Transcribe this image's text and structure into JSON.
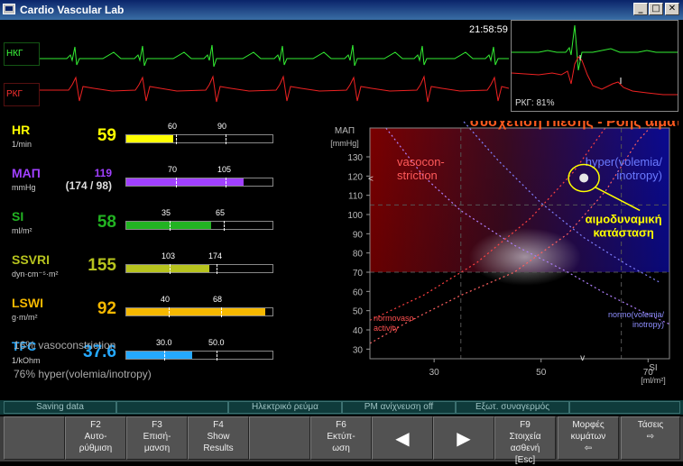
{
  "window": {
    "title": "Cardio Vascular Lab",
    "min": "_",
    "max": "□",
    "close": "✕"
  },
  "ecg": {
    "clock": "21:58:59",
    "lead1": "НКГ",
    "lead2": "РКГ",
    "mini_label": "РКГ: 81%"
  },
  "vitals": [
    {
      "name": "HR",
      "unit": "1/min",
      "value": "59",
      "color": "#ffff00",
      "ticks": [
        "60",
        "90"
      ],
      "fill_pct": 32
    },
    {
      "name": "ΜΑΠ",
      "unit": "mmHg",
      "value": "119",
      "value2": "(174 / 98)",
      "color": "#a040ff",
      "ticks": [
        "70",
        "105"
      ],
      "fill_pct": 80
    },
    {
      "name": "SI",
      "unit": "ml/m²",
      "value": "58",
      "color": "#22b322",
      "ticks": [
        "35",
        "65"
      ],
      "fill_pct": 58
    },
    {
      "name": "SSVRI",
      "unit": "dyn·cm⁻⁵·m²",
      "value": "155",
      "color": "#b7c31e",
      "ticks": [
        "103",
        "174"
      ],
      "fill_pct": 57
    },
    {
      "name": "LSWI",
      "unit": "g·m/m²",
      "value": "92",
      "color": "#f5b800",
      "ticks": [
        "40",
        "68"
      ],
      "fill_pct": 95
    },
    {
      "name": "TFC",
      "unit": "1/kOhm",
      "value": "37.6",
      "color": "#25a9ff",
      "ticks": [
        "30.0",
        "50.0"
      ],
      "fill_pct": 45
    }
  ],
  "notes": [
    "16% vasoconstriction",
    "76% hyper(volemia/inotropy)"
  ],
  "chart_data": {
    "type": "scatter",
    "title": "συσχέτιση Πίεσης - Ροής αίματος",
    "ylabel": "ΜΑΠ",
    "yunit": "[mmHg]",
    "xlabel": "SI",
    "xunit": "[ml/m²]",
    "xlim": [
      18,
      74
    ],
    "ylim": [
      25,
      145
    ],
    "xticks": [
      30,
      50,
      70
    ],
    "yticks": [
      30,
      40,
      50,
      60,
      70,
      80,
      90,
      100,
      110,
      120,
      130
    ],
    "dashed_x": [
      35,
      65
    ],
    "dashed_y": [
      70,
      105
    ],
    "points": [
      {
        "x": 58,
        "y": 119
      }
    ],
    "regions": {
      "top_left": "vasocon-\nstriction",
      "top_right": "hyper(volemia/\ninotropy)",
      "bottom_left": "normovaso-\nactivity",
      "bottom_right": "normo(volemia/\ninotropy)"
    },
    "annotation": "αιμοδυναμική\nκατάσταση"
  },
  "statusbar": [
    "Saving data",
    "",
    "Ηλεκτρικό ρεύμα",
    "PM ανίχνευση off",
    "Εξωτ. συναγερμός",
    ""
  ],
  "fkeys": [
    {
      "label": "",
      "name": "fkey-blank-1"
    },
    {
      "label": "F2\nΑυτο-\nρύθμιση",
      "name": "fkey-f2"
    },
    {
      "label": "F3\nΕπισή-\nμανση",
      "name": "fkey-f3"
    },
    {
      "label": "F4\nShow\nResults",
      "name": "fkey-f4"
    },
    {
      "label": "",
      "name": "fkey-blank-2"
    },
    {
      "label": "F6\nΕκτύπ-\nωση",
      "name": "fkey-f6"
    },
    {
      "label": "◀",
      "name": "fkey-prev"
    },
    {
      "label": "▶",
      "name": "fkey-next"
    },
    {
      "label": "F9\nΣτοιχεία ασθενή\n[Esc]",
      "name": "fkey-f9"
    },
    {
      "label": "Μορφές\nκυμάτων\n⇦",
      "name": "fkey-waveforms"
    },
    {
      "label": "Τάσεις\n⇨",
      "name": "fkey-trends"
    }
  ]
}
